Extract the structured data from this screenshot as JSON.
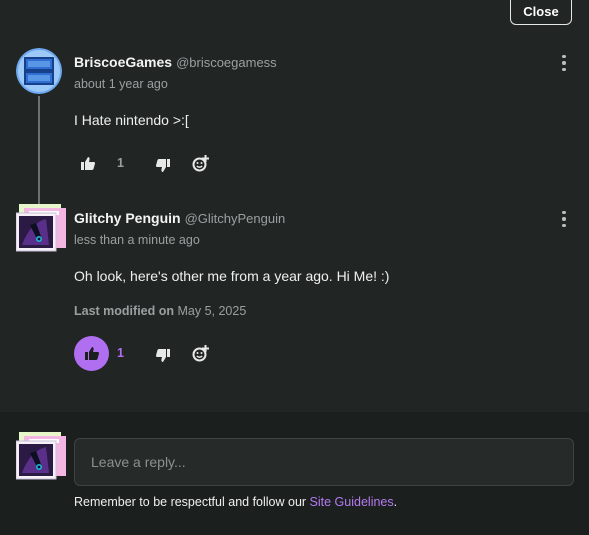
{
  "header": {
    "close_label": "Close"
  },
  "comments": [
    {
      "username": "BriscoeGames",
      "handle": "@briscoegamess",
      "time": "about 1 year ago",
      "text": "I Hate nintendo >:[",
      "like_count": "1",
      "liked": false
    },
    {
      "username": "Glitchy Penguin",
      "handle": "@GlitchyPenguin",
      "time": "less than a minute ago",
      "text": "Oh look, here's other me from a year ago. Hi Me! :)",
      "modified_label": "Last modified on",
      "modified_date": "May 5, 2025",
      "like_count": "1",
      "liked": true
    }
  ],
  "reply": {
    "placeholder": "Leave a reply...",
    "notice_text": "Remember to be respectful and follow our ",
    "guidelines_link": "Site Guidelines",
    "notice_end": "."
  },
  "colors": {
    "background": "#212625",
    "accent": "#b06ef1",
    "muted_text": "#9aa0a0"
  },
  "icons": [
    "thumbs-up-icon",
    "thumbs-down-icon",
    "add-reaction-icon",
    "more-options-icon"
  ]
}
